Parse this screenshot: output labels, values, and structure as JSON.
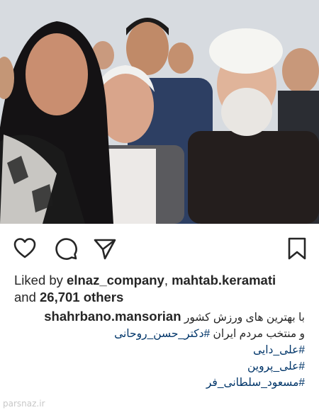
{
  "post": {
    "image_alt": "Group photo of several people",
    "likes": {
      "prefix": "Liked by",
      "user1": "elnaz_company",
      "separator": ",",
      "user2": "mahtab.keramati",
      "and": "and",
      "others": "26,701 others"
    },
    "caption": {
      "username": "shahrbano.mansorian",
      "line1": "با بهترین های ورزش کشور",
      "line2_text": "و منتخب مردم ایران",
      "hashtags": [
        "#دکتر_حسن_روحانی",
        "#علی_دایی",
        "#علی_پروین",
        "#مسعود_سلطانی_فر"
      ]
    },
    "watermark": "parsnaz.ir"
  },
  "actions": {
    "like": "heart-icon",
    "comment": "comment-icon",
    "share": "share-icon",
    "save": "bookmark-icon"
  }
}
